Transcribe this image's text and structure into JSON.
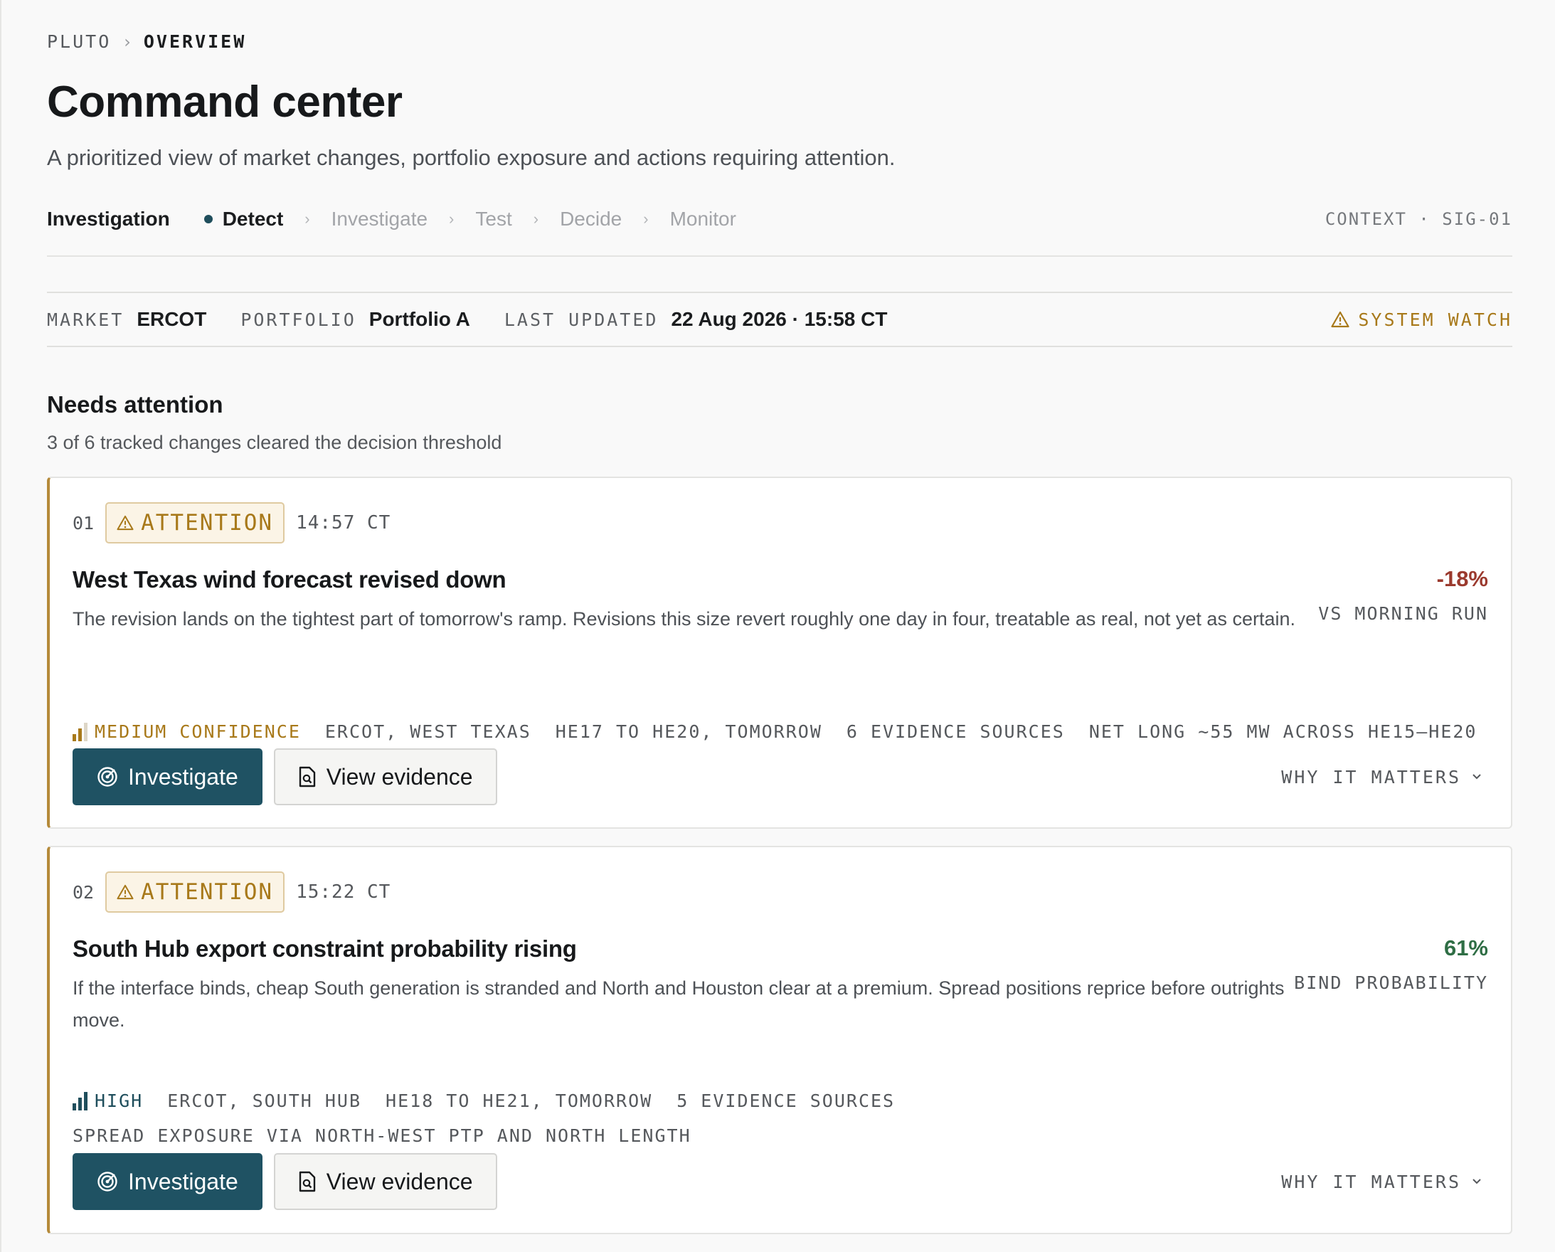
{
  "breadcrumb": {
    "root": "PLUTO",
    "current": "OVERVIEW"
  },
  "page": {
    "title": "Command center",
    "subtitle": "A prioritized view of market changes, portfolio exposure and actions requiring attention."
  },
  "stepper": {
    "label": "Investigation",
    "steps": [
      "Detect",
      "Investigate",
      "Test",
      "Decide",
      "Monitor"
    ],
    "active": "Detect",
    "context": "CONTEXT · SIG-01"
  },
  "meta": {
    "market_label": "MARKET",
    "market_value": "ERCOT",
    "portfolio_label": "PORTFOLIO",
    "portfolio_value": "Portfolio A",
    "updated_label": "LAST UPDATED",
    "updated_value": "22 Aug 2026 · 15:58 CT",
    "status": "SYSTEM WATCH"
  },
  "section": {
    "title": "Needs attention",
    "subtitle": "3 of 6 tracked changes cleared the decision threshold"
  },
  "cards": [
    {
      "index": "01",
      "badge": "ATTENTION",
      "time": "14:57 CT",
      "title": "West Texas wind forecast revised down",
      "description": "The revision lands on the tightest part of tomorrow's ramp. Revisions this size revert roughly one day in four, treatable as real, not yet as certain.",
      "metric_value": "-18%",
      "metric_caption": "VS MORNING RUN",
      "confidence": "MEDIUM CONFIDENCE",
      "confidence_level": 2,
      "tags": [
        "ERCOT, WEST TEXAS",
        "HE17 TO HE20, TOMORROW",
        "6 EVIDENCE SOURCES",
        "NET LONG ~55 MW ACROSS HE15–HE20"
      ],
      "primary_action": "Investigate",
      "secondary_action": "View evidence",
      "why_label": "WHY IT MATTERS"
    },
    {
      "index": "02",
      "badge": "ATTENTION",
      "time": "15:22 CT",
      "title": "South Hub export constraint probability rising",
      "description": "If the interface binds, cheap South generation is stranded and North and Houston clear at a premium. Spread positions reprice before outrights move.",
      "metric_value": "61%",
      "metric_caption": "BIND PROBABILITY",
      "confidence": "HIGH",
      "confidence_level": 3,
      "tags": [
        "ERCOT, SOUTH HUB",
        "HE18 TO HE21, TOMORROW",
        "5 EVIDENCE SOURCES",
        "SPREAD EXPOSURE VIA NORTH-WEST PTP AND NORTH LENGTH"
      ],
      "primary_action": "Investigate",
      "secondary_action": "View evidence",
      "why_label": "WHY IT MATTERS"
    }
  ],
  "colors": {
    "accent": "#1f5263",
    "attention": "#a8791a",
    "negative": "#9b3a2e",
    "positive": "#2f6e45"
  },
  "icons": {
    "badge": "warning-triangle-icon",
    "status": "warning-triangle-icon",
    "investigate": "radar-icon",
    "evidence": "document-search-icon",
    "why": "chevron-down-icon",
    "confidence": "signal-bars-icon"
  }
}
